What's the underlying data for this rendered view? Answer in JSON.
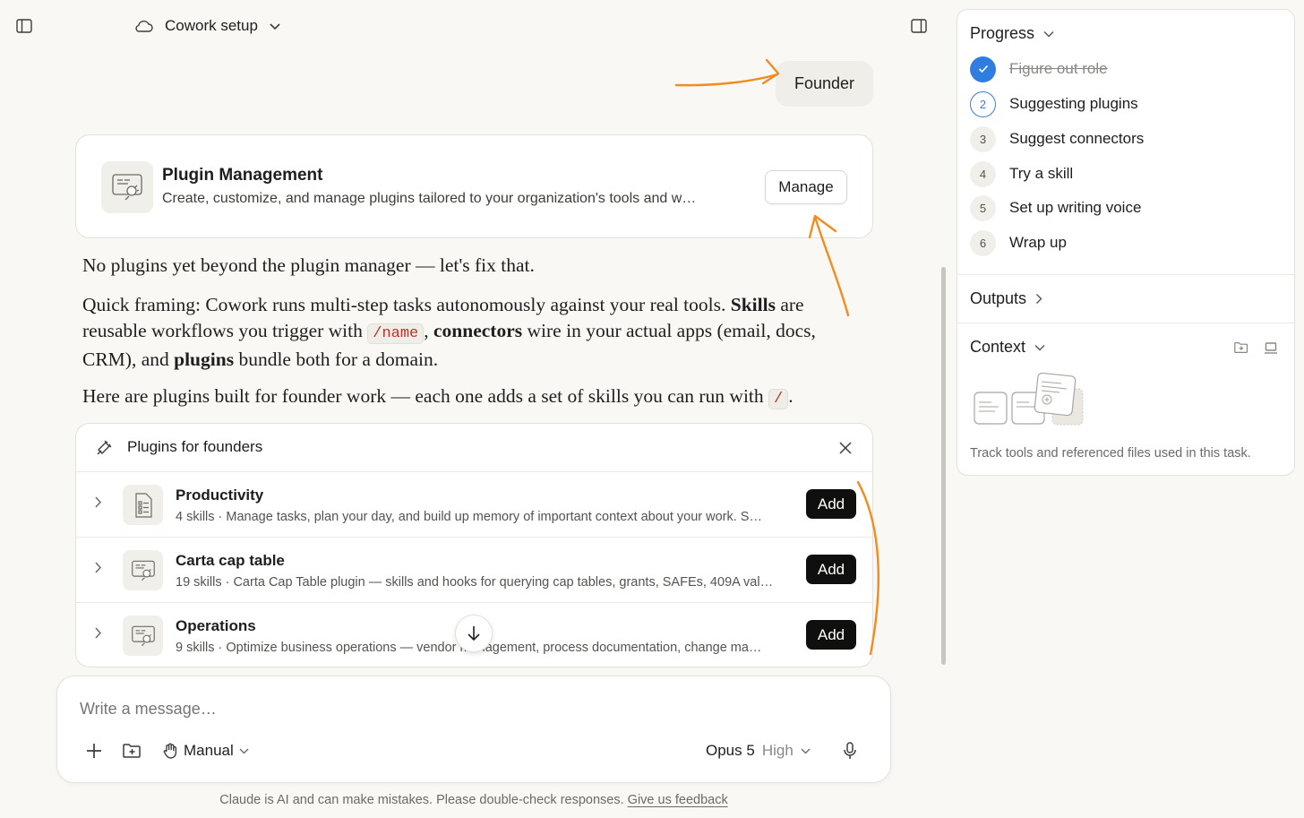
{
  "header": {
    "title": "Cowork setup"
  },
  "conversation": {
    "user_message": "Founder",
    "plugin_management": {
      "title": "Plugin Management",
      "description": "Create, customize, and manage plugins tailored to your organization's tools and w…",
      "manage_label": "Manage"
    },
    "paragraph1": "No plugins yet beyond the plugin manager — let's fix that.",
    "paragraph2": {
      "t1": "Quick framing: Cowork runs multi-step tasks autonomously against your real tools. ",
      "b1": "Skills",
      "t2": " are reusable workflows you trigger with ",
      "code1": "/name",
      "t3": ", ",
      "b2": "connectors",
      "t4": " wire in your actual apps (email, docs, CRM), and ",
      "b3": "plugins",
      "t5": " bundle both for a domain."
    },
    "paragraph3": {
      "t1": "Here are plugins built for founder work — each one adds a set of skills you can run with ",
      "code1": "/",
      "t2": "."
    },
    "plugin_list": {
      "title": "Plugins for founders",
      "add_label": "Add",
      "items": [
        {
          "name": "Productivity",
          "description": "4 skills · Manage tasks, plan your day, and build up memory of important context about your work. S…"
        },
        {
          "name": "Carta cap table",
          "description": "19 skills · Carta Cap Table plugin — skills and hooks for querying cap tables, grants, SAFEs, 409A val…"
        },
        {
          "name": "Operations",
          "description": "9 skills · Optimize business operations — vendor management, process documentation, change ma…"
        }
      ]
    }
  },
  "composer": {
    "placeholder": "Write a message…",
    "mode": "Manual",
    "model": "Opus 5",
    "effort": "High"
  },
  "disclaimer": {
    "text": "Claude is AI and can make mistakes. Please double-check responses. ",
    "link": "Give us feedback"
  },
  "panel": {
    "progress": {
      "title": "Progress",
      "steps": [
        {
          "num": "",
          "label": "Figure out role",
          "state": "done"
        },
        {
          "num": "2",
          "label": "Suggesting plugins",
          "state": "active"
        },
        {
          "num": "3",
          "label": "Suggest connectors",
          "state": "pending"
        },
        {
          "num": "4",
          "label": "Try a skill",
          "state": "pending"
        },
        {
          "num": "5",
          "label": "Set up writing voice",
          "state": "pending"
        },
        {
          "num": "6",
          "label": "Wrap up",
          "state": "pending"
        }
      ]
    },
    "outputs": {
      "title": "Outputs"
    },
    "context": {
      "title": "Context",
      "caption": "Track tools and referenced files used in this task."
    }
  },
  "colors": {
    "background": "#f9f8f5",
    "accent_blue": "#2f7de1",
    "annotation_orange": "#f28c1e",
    "button_dark": "#0f0f0e"
  }
}
